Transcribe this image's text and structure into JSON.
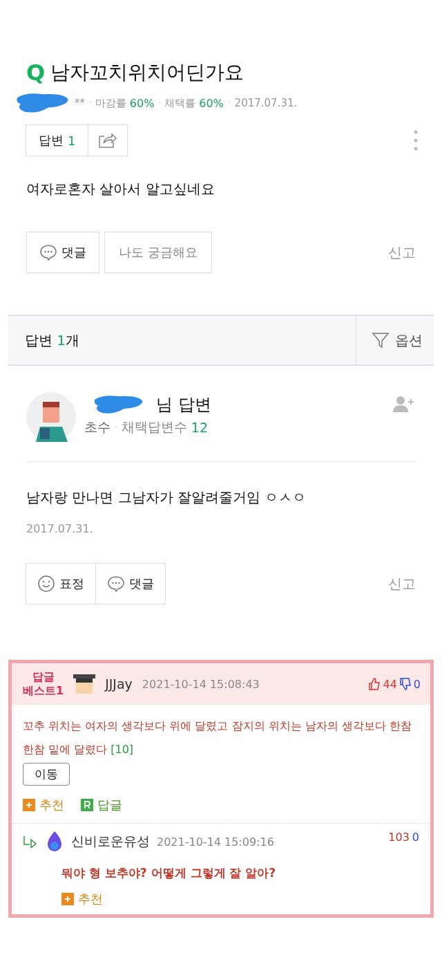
{
  "separator": "·",
  "question": {
    "mark": "Q",
    "title": "남자꼬치위치어딘가요",
    "author_tail": "**",
    "meta": [
      {
        "label": "마감률",
        "value": "60%"
      },
      {
        "label": "채택률",
        "value": "60%"
      }
    ],
    "date": "2017.07.31.",
    "answer_count_label": "답변",
    "answer_count": "1",
    "body": "여자로혼자 살아서 알고싶네요",
    "actions": [
      {
        "kind": "comment",
        "label": "댓글"
      },
      {
        "kind": "plain",
        "label": "나도 궁금해요"
      }
    ],
    "report": "신고"
  },
  "answers_header": {
    "label": "답변",
    "count": "1",
    "unit": "개",
    "option": "옵션"
  },
  "answer": {
    "name_tail": "님 답변",
    "level": "초수",
    "stat_label": "채택답변수",
    "stat_value": "12",
    "body": "남자랑 만나면 그남자가 잘알려줄거임 ㅇㅅㅇ",
    "date": "2017.07.31.",
    "actions": [
      {
        "kind": "emoji",
        "label": "표정"
      },
      {
        "kind": "comment",
        "label": "댓글"
      }
    ],
    "report": "신고"
  },
  "best_comment": {
    "badge_line1": "답글",
    "badge_line2": "베스트1",
    "user": "JJJay",
    "time": "2021-10-14 15:08:43",
    "likes": "44",
    "dislikes": "0",
    "body": "꼬추 위치는 여자의 생각보다 위에 달렸고 잠지의 위치는 남자의 생각보다 한참 한참 밑에 달렸다",
    "reply_count": "[10]",
    "move": "이동",
    "recommend": "추천",
    "reply": "답글",
    "replies": [
      {
        "user": "신비로운유성",
        "time": "2021-10-14 15:09:16",
        "likes": "103",
        "dislikes": "0",
        "body": "뭐야 형 보추야? 어떻게 그렇게 잘 알아?",
        "recommend": "추천"
      }
    ]
  }
}
